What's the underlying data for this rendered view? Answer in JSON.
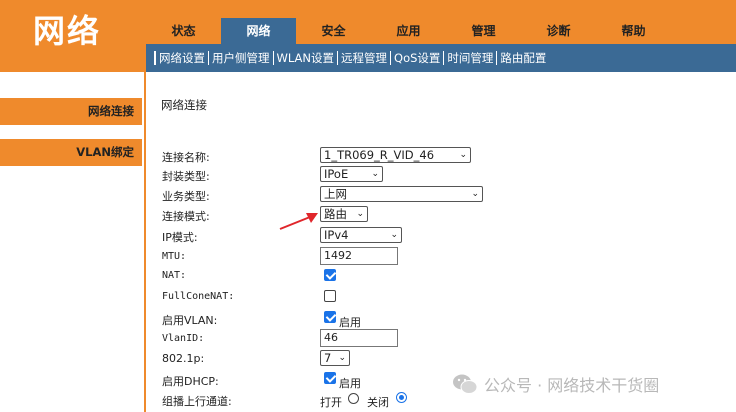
{
  "brand": "网络",
  "tabs": [
    {
      "label": "状态",
      "active": false
    },
    {
      "label": "网络",
      "active": true
    },
    {
      "label": "安全",
      "active": false
    },
    {
      "label": "应用",
      "active": false
    },
    {
      "label": "管理",
      "active": false
    },
    {
      "label": "诊断",
      "active": false
    },
    {
      "label": "帮助",
      "active": false
    }
  ],
  "subnav": [
    "网络设置",
    "用户侧管理",
    "WLAN设置",
    "远程管理",
    "QoS设置",
    "时间管理",
    "路由配置"
  ],
  "sidebar": [
    {
      "label": "网络连接"
    },
    {
      "label": "VLAN绑定"
    }
  ],
  "main": {
    "section_title": "网络连接",
    "fields": {
      "conn_name": {
        "label": "连接名称:",
        "value": "1_TR069_R_VID_46"
      },
      "encap": {
        "label": "封装类型:",
        "value": "IPoE"
      },
      "service": {
        "label": "业务类型:",
        "value": "上网"
      },
      "mode": {
        "label": "连接模式:",
        "value": "路由"
      },
      "ip_mode": {
        "label": "IP模式:",
        "value": "IPv4"
      },
      "mtu": {
        "label": "MTU:",
        "value": "1492"
      },
      "nat": {
        "label": "NAT:",
        "checked": true
      },
      "fullcone": {
        "label": "FullConeNAT:",
        "checked": false
      },
      "vlan_enable": {
        "label": "启用VLAN:",
        "checked": true,
        "text": "启用"
      },
      "vlanid": {
        "label": "VlanID:",
        "value": "46"
      },
      "p8021": {
        "label": "802.1p:",
        "value": "7"
      },
      "dhcp_enable": {
        "label": "启用DHCP:",
        "checked": true,
        "text": "启用"
      },
      "multicast": {
        "label": "组播上行通道:",
        "on_label": "打开",
        "off_label": "关闭",
        "selected": "off"
      }
    }
  },
  "watermark": "公众号 · 网络技术干货圈",
  "colors": {
    "orange": "#ef8a2c",
    "blue": "#3b6a95",
    "accent": "#1a73e8",
    "arrow": "#e0262b"
  }
}
